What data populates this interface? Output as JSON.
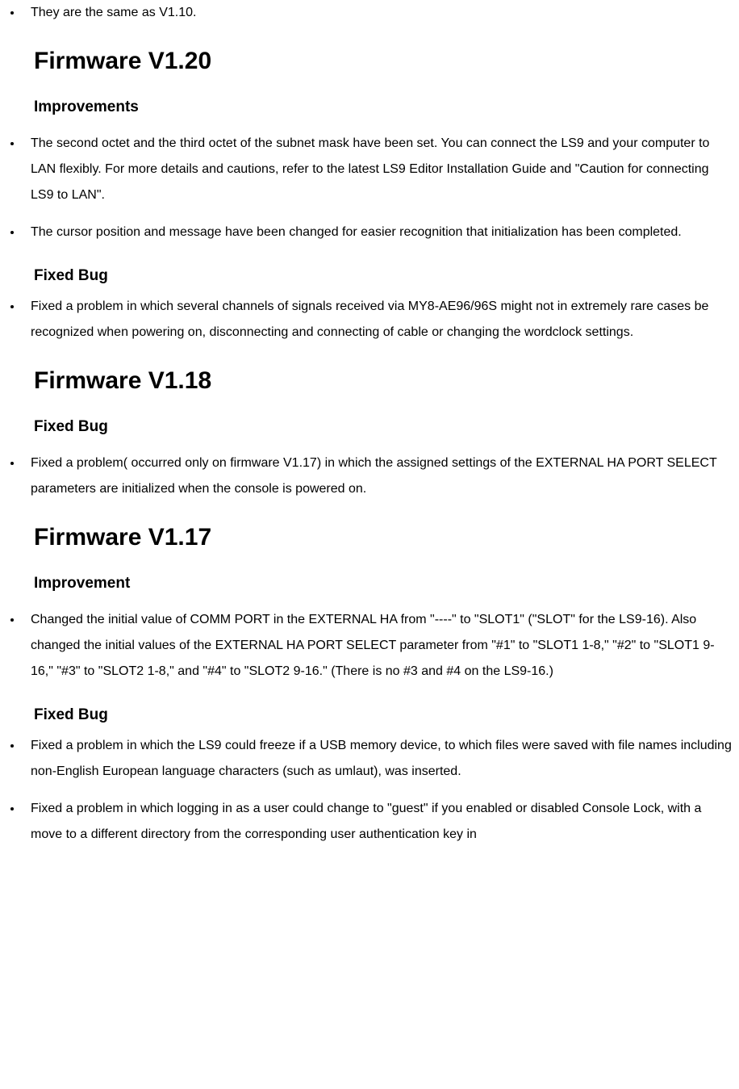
{
  "intro_item": "They are the same as V1.10.",
  "sections": {
    "v120": {
      "heading": "Firmware V1.20",
      "sub_improvements": "Improvements",
      "imp_items": [
        "The second octet and the third octet of the subnet mask have been set. You can connect the LS9 and your computer to LAN flexibly. For more details and cautions, refer to the latest LS9 Editor Installation Guide and \"Caution for connecting LS9 to LAN\".",
        "The cursor position and message have been changed for easier recognition that initialization has been completed."
      ],
      "sub_fixed": "Fixed Bug",
      "fix_items": [
        "Fixed a problem in which several channels of signals received via MY8-AE96/96S might not in extremely rare cases be recognized when powering on, disconnecting and connecting of cable or changing the wordclock settings."
      ]
    },
    "v118": {
      "heading": "Firmware V1.18",
      "sub_fixed": "Fixed Bug",
      "fix_items": [
        "Fixed a problem( occurred only on firmware V1.17) in which the assigned settings of the EXTERNAL HA PORT SELECT parameters are initialized when the console is powered on."
      ]
    },
    "v117": {
      "heading": "Firmware V1.17",
      "sub_improvement": "Improvement",
      "imp_items": [
        "Changed the initial value of COMM PORT in the EXTERNAL HA from \"----\" to \"SLOT1\" (\"SLOT\" for the LS9-16). Also changed the initial values of the EXTERNAL HA PORT SELECT parameter from \"#1\" to \"SLOT1 1-8,\" \"#2\" to \"SLOT1 9-16,\" \"#3\" to \"SLOT2 1-8,\" and \"#4\" to \"SLOT2 9-16.\" (There is no #3 and #4 on the LS9-16.)"
      ],
      "sub_fixed": "Fixed Bug",
      "fix_items": [
        "Fixed a problem in which the LS9 could freeze if a USB memory device, to which files were saved with file names including non-English European language characters (such as umlaut), was inserted.",
        "Fixed a problem in which logging in as a user could change to \"guest\" if you enabled or disabled Console Lock, with a move to a different directory from the corresponding user authentication key in"
      ]
    }
  }
}
